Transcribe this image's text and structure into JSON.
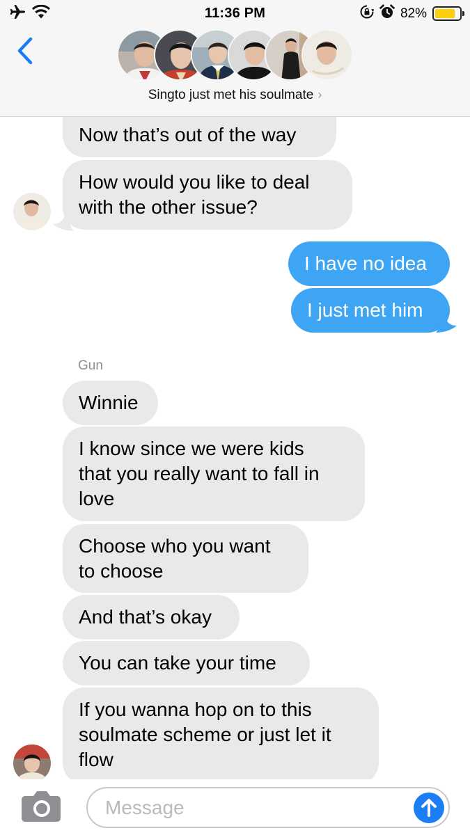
{
  "status_bar": {
    "time": "11:36 PM",
    "battery_percent_label": "82%",
    "battery_level": 0.82,
    "icons": [
      "airplane-icon",
      "wifi-icon",
      "orientation-lock-icon",
      "alarm-icon",
      "battery-icon"
    ]
  },
  "header": {
    "conversation_title": "Singto just met his soulmate",
    "title_chevron": "›",
    "back_icon": "chevron-left-icon",
    "participant_count": 6
  },
  "messages": {
    "m1": "Now that’s out of the way",
    "m2_line1": "How would you like to deal",
    "m2_line2": "with the other issue?",
    "m3": "I have no idea",
    "m4": "I just met him",
    "sender_name": "Gun",
    "m5": "Winnie",
    "m6_line1": "I know since we were kids",
    "m6_line2": "that you really want to fall in",
    "m6_line3": "love",
    "m7_line1": "Choose who you want",
    "m7_line2": "to choose",
    "m8": "And that’s okay",
    "m9": "You can take your time",
    "m10_line1": "If you wanna hop on to this",
    "m10_line2": "soulmate scheme or just let it",
    "m10_line3": "flow"
  },
  "input_bar": {
    "placeholder": "Message",
    "camera_icon": "camera-icon",
    "send_icon": "arrow-up-icon"
  },
  "colors": {
    "incoming_bubble": "#e9e9eb",
    "outgoing_bubble": "#3ea5f5",
    "accent": "#1b7ef5",
    "back_chevron": "#1a7cf4",
    "battery_fill": "#fccf0c"
  }
}
